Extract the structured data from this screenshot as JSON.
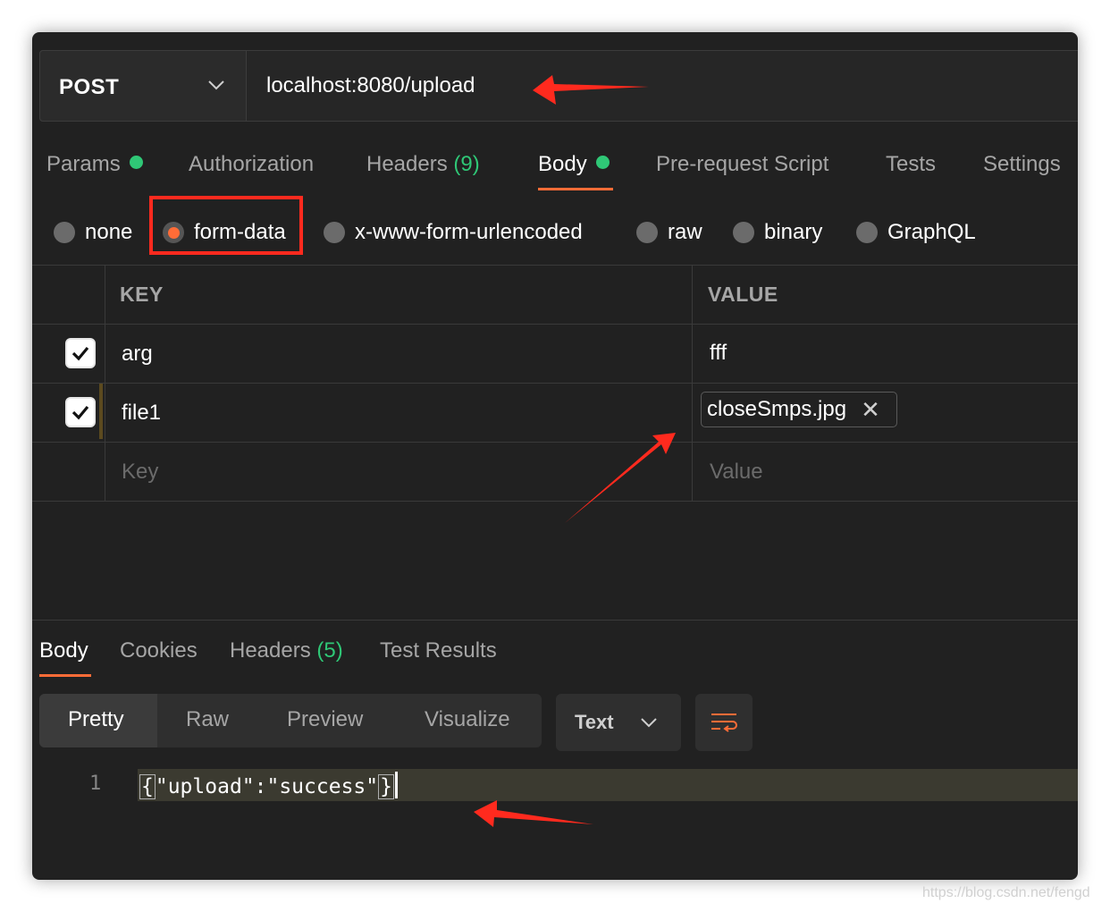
{
  "request": {
    "method": "POST",
    "url": "localhost:8080/upload"
  },
  "request_tabs": [
    {
      "label": "Params",
      "dot": true
    },
    {
      "label": "Authorization"
    },
    {
      "label": "Headers",
      "count": "(9)"
    },
    {
      "label": "Body",
      "dot": true,
      "active": true
    },
    {
      "label": "Pre-request Script"
    },
    {
      "label": "Tests"
    },
    {
      "label": "Settings"
    }
  ],
  "body_types": [
    "none",
    "form-data",
    "x-www-form-urlencoded",
    "raw",
    "binary",
    "GraphQL"
  ],
  "selected_body_type": "form-data",
  "form_table": {
    "headers": {
      "key": "KEY",
      "value": "VALUE"
    },
    "rows": [
      {
        "checked": true,
        "key": "arg",
        "value": "fff"
      },
      {
        "checked": true,
        "key": "file1",
        "file": "closeSmps.jpg"
      }
    ],
    "placeholder_key": "Key",
    "placeholder_value": "Value"
  },
  "response_tabs": [
    {
      "label": "Body",
      "active": true
    },
    {
      "label": "Cookies"
    },
    {
      "label": "Headers",
      "count": "(5)"
    },
    {
      "label": "Test Results"
    }
  ],
  "view_modes": [
    "Pretty",
    "Raw",
    "Preview",
    "Visualize"
  ],
  "active_view_mode": "Pretty",
  "format_dropdown": "Text",
  "response_code": {
    "line_number": "1",
    "open_brace": "{",
    "content": "\"upload\":\"success\"",
    "close_brace": "}"
  },
  "watermark": "https://blog.csdn.net/fengd",
  "colors": {
    "accent": "#ff6c37",
    "status_green": "#2fc776",
    "annotation_red": "#ff2a1e",
    "background": "#212121"
  },
  "icons": [
    "chevron-down-icon",
    "checkmark-icon",
    "close-icon",
    "wrap-lines-icon"
  ]
}
